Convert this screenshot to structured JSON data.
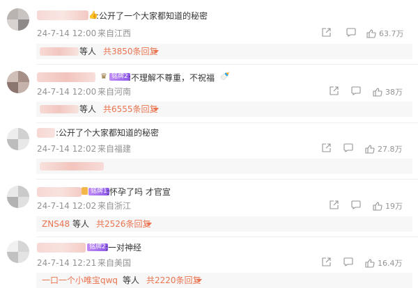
{
  "comments": [
    {
      "content": ":公开了一个大家都知道的秘密",
      "date": "24-7-14 12:00",
      "location": "来自江西",
      "likes": "63.7万",
      "reply_suffix": "等人",
      "reply_count": "共3850条回复"
    },
    {
      "badge": "铭牌2",
      "content": ":不理解不尊重，不祝福",
      "date": "24-7-14 12:00",
      "location": "来自河南",
      "likes": "38万",
      "reply_suffix": "等人",
      "reply_count": "共6555条回复"
    },
    {
      "content": ":公开了个大家都知道的秘密",
      "date": "24-7-14 12:02",
      "location": "来自福建",
      "likes": "27.8万"
    },
    {
      "badge": "铭牌1",
      "content": ":怀孕了吗 才官宣",
      "date": "24-7-14 12:02",
      "location": "来自浙江",
      "likes": "19万",
      "reply_user": "ZNS48",
      "reply_suffix": "等人",
      "reply_count": "共2526条回复"
    },
    {
      "badge": "铭牌2",
      "content": ":一对神经",
      "date": "24-7-14 12:21",
      "location": "来自美国",
      "likes": "16.4万",
      "reply_user": "一口一个小唯宝qwq",
      "reply_suffix": "等人",
      "reply_count": "共2220条回复"
    }
  ],
  "icons": {
    "share": "share-icon",
    "comment": "comment-icon",
    "like": "like-icon"
  },
  "colors": {
    "accent": "#eb7350",
    "meta": "#939393"
  }
}
